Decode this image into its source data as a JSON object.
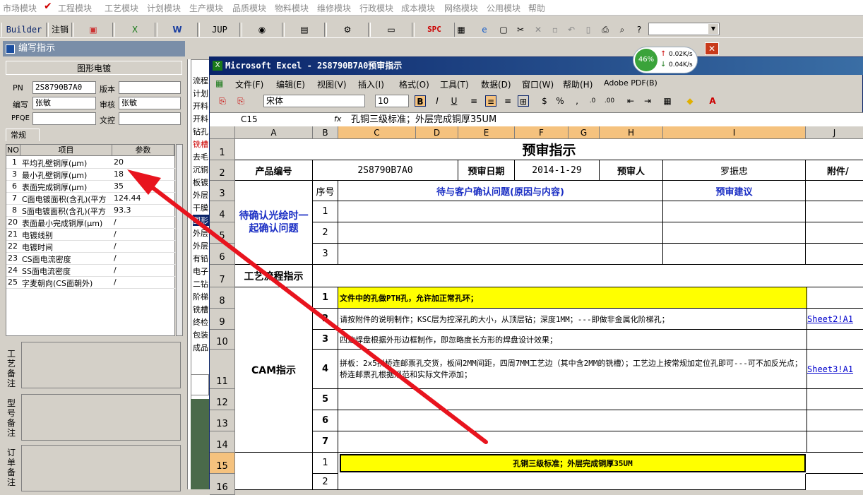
{
  "menubar": {
    "items": [
      "市场模块",
      "工程模块",
      "工艺模块",
      "计划模块",
      "生产模块",
      "品质模块",
      "物料模块",
      "维修模块",
      "行政模块",
      "成本模块",
      "网络模块",
      "公用模块",
      "帮助"
    ]
  },
  "toolbar": {
    "builder": "Builder",
    "logout": "注销",
    "jup": "JUP",
    "spc": "SPC"
  },
  "left_window": {
    "title": "编写指示",
    "section": "图形电镀",
    "pn_label": "PN",
    "pn_value": "2S8790B7A0",
    "version_label": "版本",
    "version_value": "",
    "writer_label": "编写",
    "writer_value": "张敏",
    "review_label": "审核",
    "review_value": "张敏",
    "pfqe_label": "PFQE",
    "pfqe_value": "",
    "wenkong_label": "文控",
    "wenkong_value": "",
    "tab": "常规",
    "table_headers": [
      "NO",
      "项目",
      "参数"
    ],
    "rows": [
      {
        "no": "1",
        "item": "平均孔壁铜厚(μm)",
        "param": "20"
      },
      {
        "no": "3",
        "item": "最小孔壁铜厚(μm)",
        "param": "18"
      },
      {
        "no": "6",
        "item": "表面完成铜厚(μm)",
        "param": "35"
      },
      {
        "no": "7",
        "item": "C面电镀面积(含孔)(平方",
        "param": "124.44"
      },
      {
        "no": "8",
        "item": "S面电镀面积(含孔)(平方",
        "param": "93.3"
      },
      {
        "no": "20",
        "item": "表面最小完成铜厚(μm)",
        "param": "/"
      },
      {
        "no": "21",
        "item": "电镀线别",
        "param": "/"
      },
      {
        "no": "22",
        "item": "电镀时间",
        "param": "/"
      },
      {
        "no": "23",
        "item": "CS面电流密度",
        "param": "/"
      },
      {
        "no": "24",
        "item": "SS面电流密度",
        "param": "/"
      },
      {
        "no": "25",
        "item": "字麦朝向(CS面朝外)",
        "param": "/"
      }
    ],
    "notes": [
      "工艺备注",
      "型号备注",
      "订单备注"
    ]
  },
  "middle_list": [
    "流程",
    "计划",
    "开料",
    "开料",
    "钻孔",
    "铣槽",
    "去毛",
    "沉铜",
    "板镀",
    "外层",
    "干膜",
    "图形",
    "外层",
    "外层",
    "有铅",
    "电子",
    "二钻",
    "阶梯",
    "铣槽",
    "终检",
    "包装",
    "成品"
  ],
  "excel": {
    "title": "Microsoft Excel - 2S8790B7A0预审指示",
    "menu": [
      "文件(F)",
      "编辑(E)",
      "视图(V)",
      "插入(I)",
      "格式(O)",
      "工具(T)",
      "数据(D)",
      "窗口(W)",
      "帮助(H)",
      "Adobe PDF(B)"
    ],
    "font_name": "宋体",
    "font_size": "10",
    "name_box": "C15",
    "fx": "fx",
    "formula": "孔铜三级标准；外层完成铜厚35UM",
    "columns": [
      "A",
      "B",
      "C",
      "D",
      "E",
      "F",
      "G",
      "H",
      "I",
      "J"
    ],
    "row_numbers": [
      "1",
      "2",
      "3",
      "4",
      "5",
      "6",
      "7",
      "8",
      "9",
      "10",
      "11",
      "12",
      "13",
      "14",
      "15",
      "16"
    ],
    "sheet_title": "预审指示",
    "product_no_label": "产品编号",
    "product_no": "2S8790B7A0",
    "review_date_label": "预审日期",
    "review_date": "2014-1-29",
    "reviewer_label": "预审人",
    "reviewer": "罗振忠",
    "attach_label": "附件/",
    "seq_label": "序号",
    "question_header": "待与客户确认问题(原因与内容)",
    "suggest_header": "预审建议",
    "pending_label": "待确认光绘时一起确认问题",
    "process_label": "工艺流程指示",
    "cam_label": "CAM指示",
    "seq": [
      "1",
      "2",
      "3",
      "1",
      "2",
      "3",
      "4",
      "5",
      "6",
      "7",
      "1",
      "2"
    ],
    "cam_items": [
      "文件中的孔做PTH孔，允许加正常孔环；",
      "请按附件的说明制作；KSC层为控深孔的大小，从顶层钻；深度1MM；---即做非金属化阶梯孔；",
      "四边焊盘根据外形边框制作，即忽略度长方形的焊盘设计效果；",
      "拼板：2x5拼桥连邮票孔交货，板间2MM间距，四周7MM工艺边（其中含2MM的铣槽）；工艺边上按常规加定位孔即可---可不加反光点；桥连邮票孔根据规范和实际文件添加；"
    ],
    "links": [
      "Sheet2!A1",
      "Sheet3!A1"
    ],
    "row15_text": "孔铜三级标准；外层完成铜厚35UM"
  },
  "net_widget": {
    "percent": "46%",
    "up": "0.02K/s",
    "down": "0.04K/s"
  },
  "colors": {
    "arrow": "#e8141e",
    "highlight": "#ffff00",
    "header_blue": "#1a2ec4"
  }
}
